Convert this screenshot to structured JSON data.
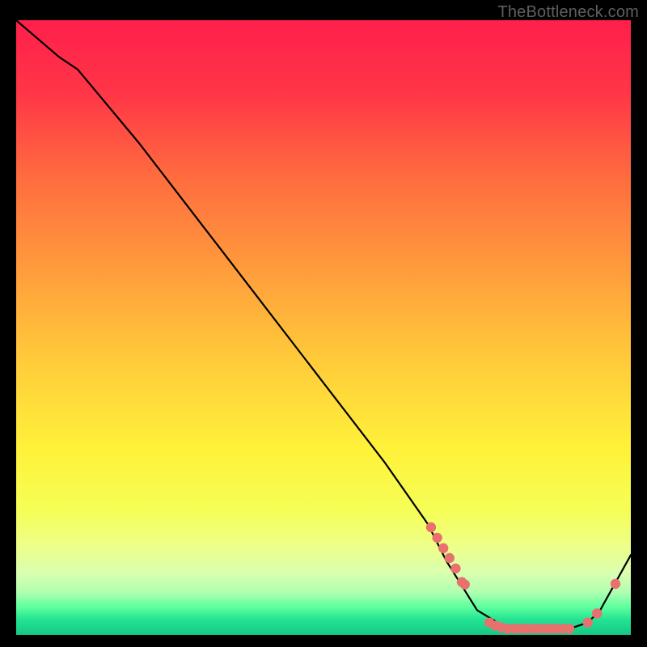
{
  "watermark": "TheBottleneck.com",
  "chart_data": {
    "type": "line",
    "title": "",
    "xlabel": "",
    "ylabel": "",
    "xlim": [
      0,
      100
    ],
    "ylim": [
      0,
      100
    ],
    "curve": {
      "x": [
        0,
        7,
        10,
        20,
        30,
        40,
        50,
        60,
        67,
        70,
        75,
        80,
        85,
        90,
        93,
        95,
        100
      ],
      "y": [
        100,
        94,
        92,
        80,
        67,
        54,
        41,
        28,
        18,
        12,
        4,
        1,
        1,
        1,
        2,
        4,
        13
      ]
    },
    "marker_series": {
      "color": "#e8716f",
      "x": [
        67.5,
        68.5,
        69.5,
        70.5,
        71.5,
        72.5,
        73.0,
        77.0,
        78.0,
        79.0,
        80.0,
        81.0,
        82.0,
        83.0,
        84.0,
        85.0,
        86.0,
        87.0,
        88.0,
        89.0,
        90.0,
        93.0,
        94.5,
        97.5
      ],
      "y": [
        17.5,
        15.8,
        14.1,
        12.5,
        10.8,
        8.6,
        8.2,
        2.0,
        1.5,
        1.2,
        1.0,
        1.0,
        1.0,
        1.0,
        1.0,
        1.0,
        1.0,
        1.0,
        1.0,
        1.0,
        1.0,
        2.0,
        3.5,
        8.3
      ]
    },
    "background_gradient": {
      "stops": [
        {
          "offset": 0.0,
          "color": "#ff1f4b"
        },
        {
          "offset": 0.12,
          "color": "#ff3647"
        },
        {
          "offset": 0.25,
          "color": "#ff6a3f"
        },
        {
          "offset": 0.4,
          "color": "#ff9a3c"
        },
        {
          "offset": 0.55,
          "color": "#ffca3a"
        },
        {
          "offset": 0.7,
          "color": "#fff23a"
        },
        {
          "offset": 0.8,
          "color": "#f5ff57"
        },
        {
          "offset": 0.86,
          "color": "#ecff8d"
        },
        {
          "offset": 0.9,
          "color": "#d9ffb0"
        },
        {
          "offset": 0.93,
          "color": "#b1ffb0"
        },
        {
          "offset": 0.955,
          "color": "#5eff9e"
        },
        {
          "offset": 0.975,
          "color": "#23e493"
        },
        {
          "offset": 1.0,
          "color": "#17c884"
        }
      ]
    }
  }
}
